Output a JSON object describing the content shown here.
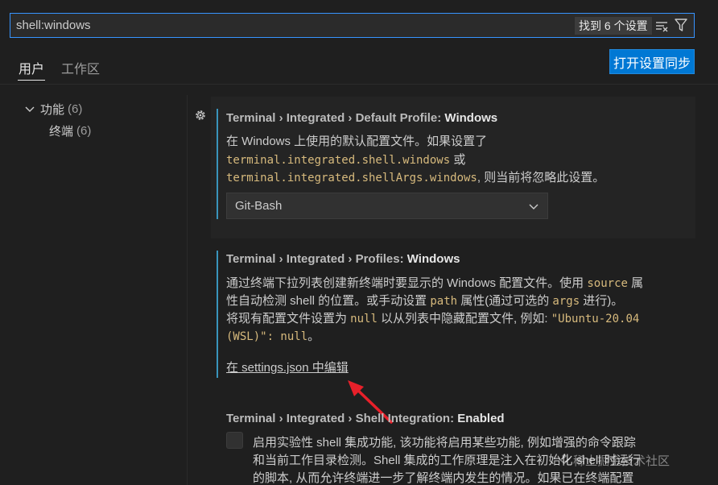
{
  "search": {
    "value": "shell:windows",
    "result_count": "找到 6 个设置"
  },
  "tabs": [
    {
      "label": "用户",
      "active": true
    },
    {
      "label": "工作区",
      "active": false
    }
  ],
  "sync_button_label": "打开设置同步",
  "toc": {
    "group": {
      "label": "功能",
      "count": "(6)"
    },
    "item": {
      "label": "终端",
      "count": "(6)"
    }
  },
  "settings": {
    "default_profile": {
      "category": "Terminal › Integrated › Default Profile: ",
      "key": "Windows",
      "desc_line1": "在 Windows 上使用的默认配置文件。如果设置了",
      "desc_code1": "terminal.integrated.shell.windows",
      "desc_line2_suffix": " 或",
      "desc_code2": "terminal.integrated.shellArgs.windows",
      "desc_line3_suffix": ", 则当前将忽略此设置。",
      "selected_value": "Git-Bash"
    },
    "profiles": {
      "category": "Terminal › Integrated › Profiles: ",
      "key": "Windows",
      "desc_line1_a": "通过终端下拉列表创建新终端时要显示的 Windows 配置文件。使用 ",
      "desc_line1_code": "source",
      "desc_line1_b": " 属",
      "desc_line2_a": "性自动检测 shell 的位置。或手动设置 ",
      "desc_line2_code1": "path",
      "desc_line2_b": " 属性(通过可选的 ",
      "desc_line2_code2": "args",
      "desc_line2_c": " 进行)。",
      "desc_line3_a": "将现有配置文件设置为 ",
      "desc_line3_code1": "null",
      "desc_line3_b": " 以从列表中隐藏配置文件, 例如: ",
      "desc_line3_code2": "\"Ubuntu-20.04",
      "desc_line4_code": "(WSL)\": null",
      "desc_line4_suffix": "。",
      "edit_link": "在 settings.json 中编辑"
    },
    "shell_integration": {
      "category": "Terminal › Integrated › Shell Integration: ",
      "key": "Enabled",
      "desc_line1": "启用实验性 shell 集成功能, 该功能将启用某些功能, 例如增强的命令跟踪",
      "desc_line2": "和当前工作目录检测。Shell 集成的工作原理是注入在初始化 shell 时运行",
      "desc_line3": "的脚本, 从而允许终端进一步了解终端内发生的情况。如果已在终端配置",
      "checked": false
    }
  },
  "watermark": "稀土掘金技术社区",
  "colors": {
    "accent": "#3794ff",
    "button": "#0078d4",
    "code": "#d7ba7d",
    "modified_bar": "#3994bc",
    "annotation_arrow": "#e8202a"
  }
}
